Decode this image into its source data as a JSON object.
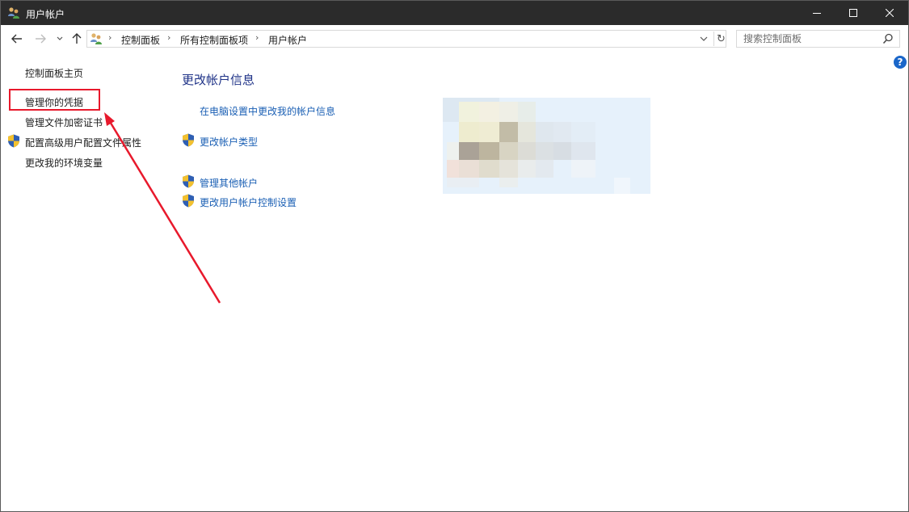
{
  "window": {
    "title": "用户帐户"
  },
  "nav": {
    "breadcrumbs": [
      "控制面板",
      "所有控制面板项",
      "用户帐户"
    ],
    "search_placeholder": "搜索控制面板"
  },
  "sidebar": {
    "items": [
      {
        "label": "控制面板主页",
        "shield": false
      },
      {
        "label": "管理你的凭据",
        "shield": false
      },
      {
        "label": "管理文件加密证书",
        "shield": false
      },
      {
        "label": "配置高级用户配置文件属性",
        "shield": true
      },
      {
        "label": "更改我的环境变量",
        "shield": false
      }
    ]
  },
  "main": {
    "title": "更改帐户信息",
    "links": [
      {
        "label": "在电脑设置中更改我的帐户信息",
        "shield": false
      },
      {
        "label": "更改帐户类型",
        "shield": true
      },
      {
        "label": "管理其他帐户",
        "shield": true
      },
      {
        "label": "更改用户帐户控制设置",
        "shield": true
      }
    ]
  },
  "icons": {
    "title": "users-icon",
    "address": "users-icon",
    "help": "help-icon",
    "shield": "uac-shield-icon"
  },
  "colors": {
    "titlebar": "#2b2b2b",
    "link": "#1a5fb4",
    "heading": "#1e3287",
    "highlight": "#e8192c",
    "avatar_bg": "#e6f1fb"
  }
}
